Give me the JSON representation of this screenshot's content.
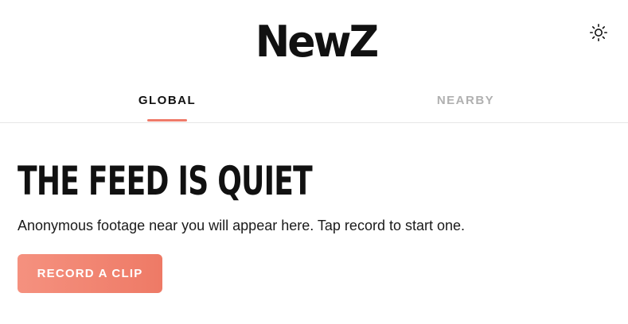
{
  "header": {
    "logo_text": "NewZ",
    "theme_toggle_icon": "sun-icon"
  },
  "tabs": [
    {
      "label": "GLOBAL",
      "active": true
    },
    {
      "label": "NEARBY",
      "active": false
    }
  ],
  "colors": {
    "accent": "#ef7b6a",
    "text_primary": "#111111",
    "tab_inactive": "#b0b0b0",
    "divider": "#e6e6e6"
  },
  "empty_state": {
    "title": "THE FEED IS QUIET",
    "description": "Anonymous footage near you will appear here. Tap record to start one.",
    "action_label": "RECORD A CLIP"
  }
}
